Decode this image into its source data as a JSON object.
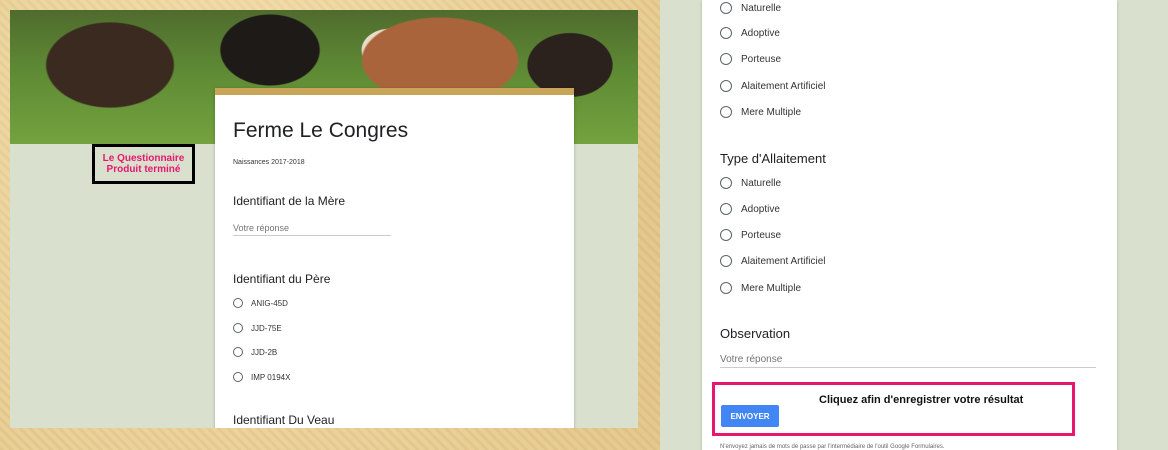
{
  "left": {
    "form_title": "Ferme Le Congres",
    "form_description": "Naissances 2017-2018",
    "annotation": "Le Questionnaire Produit terminé",
    "q_mere": {
      "title": "Identifiant de la Mère",
      "placeholder": "Votre réponse"
    },
    "q_pere": {
      "title": "Identifiant du Père",
      "options": [
        "ANIG-45D",
        "JJD-75E",
        "JJD-2B",
        "IMP 0194X"
      ]
    },
    "q_veau": {
      "title": "Identifiant Du Veau"
    }
  },
  "right": {
    "group1_options": [
      "Naturelle",
      "Adoptive",
      "Porteuse",
      "Alaitement Artificiel",
      "Mere Multiple"
    ],
    "q_allaitement": {
      "title": "Type d'Allaitement",
      "options": [
        "Naturelle",
        "Adoptive",
        "Porteuse",
        "Alaitement Artificiel",
        "Mere Multiple"
      ]
    },
    "q_observation": {
      "title": "Observation",
      "placeholder": "Votre réponse"
    },
    "submit_label": "ENVOYER",
    "submit_annotation": "Cliquez afin d'enregistrer votre résultat",
    "footer": "N'envoyez jamais de mots de passe par l'intermédiaire de l'outil Google Formulaires."
  }
}
